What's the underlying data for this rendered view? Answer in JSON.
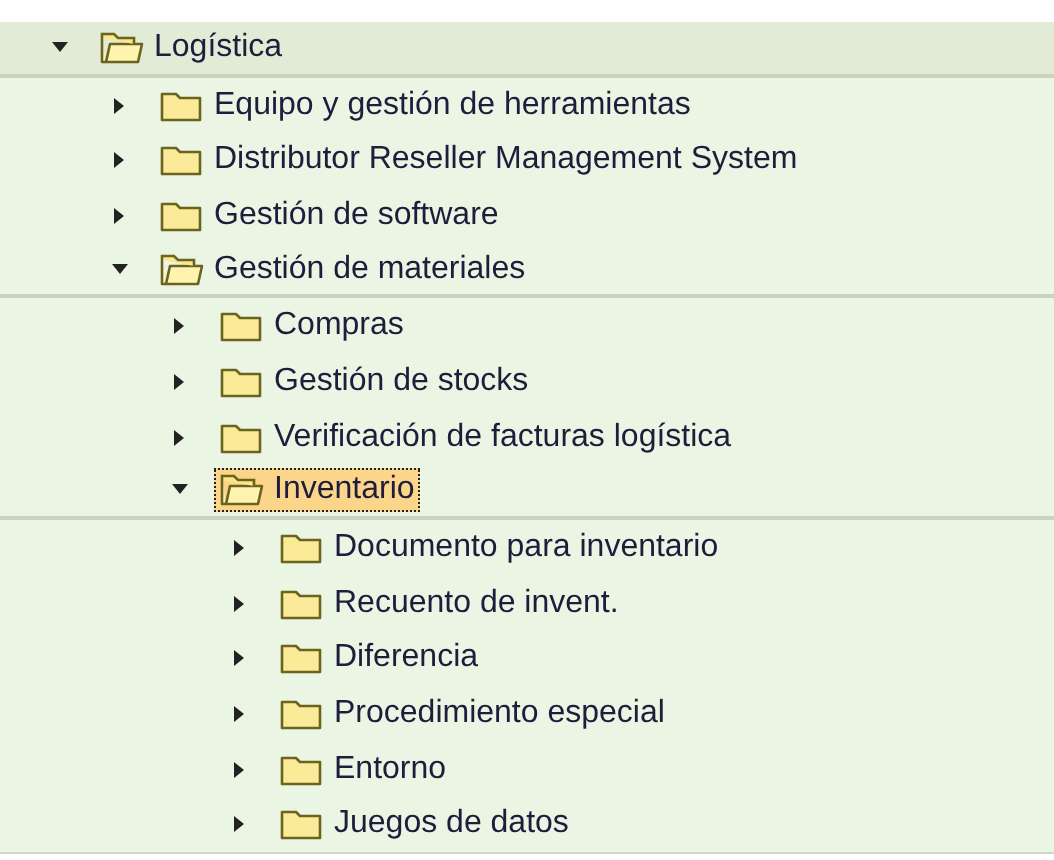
{
  "tree": [
    {
      "label": "Logística",
      "expanded": true,
      "selected": false,
      "children": [
        {
          "label": "Equipo y gestión de herramientas",
          "expanded": false,
          "selected": false
        },
        {
          "label": "Distributor Reseller Management System",
          "expanded": false,
          "selected": false
        },
        {
          "label": "Gestión de software",
          "expanded": false,
          "selected": false
        },
        {
          "label": "Gestión de materiales",
          "expanded": true,
          "selected": false,
          "children": [
            {
              "label": "Compras",
              "expanded": false,
              "selected": false
            },
            {
              "label": "Gestión de stocks",
              "expanded": false,
              "selected": false
            },
            {
              "label": "Verificación de facturas logística",
              "expanded": false,
              "selected": false
            },
            {
              "label": "Inventario",
              "expanded": true,
              "selected": true,
              "children": [
                {
                  "label": "Documento para inventario",
                  "expanded": false,
                  "selected": false
                },
                {
                  "label": "Recuento de invent.",
                  "expanded": false,
                  "selected": false
                },
                {
                  "label": "Diferencia",
                  "expanded": false,
                  "selected": false
                },
                {
                  "label": "Procedimiento especial",
                  "expanded": false,
                  "selected": false
                },
                {
                  "label": "Entorno",
                  "expanded": false,
                  "selected": false
                },
                {
                  "label": "Juegos de datos",
                  "expanded": false,
                  "selected": false
                }
              ]
            }
          ]
        }
      ]
    }
  ]
}
